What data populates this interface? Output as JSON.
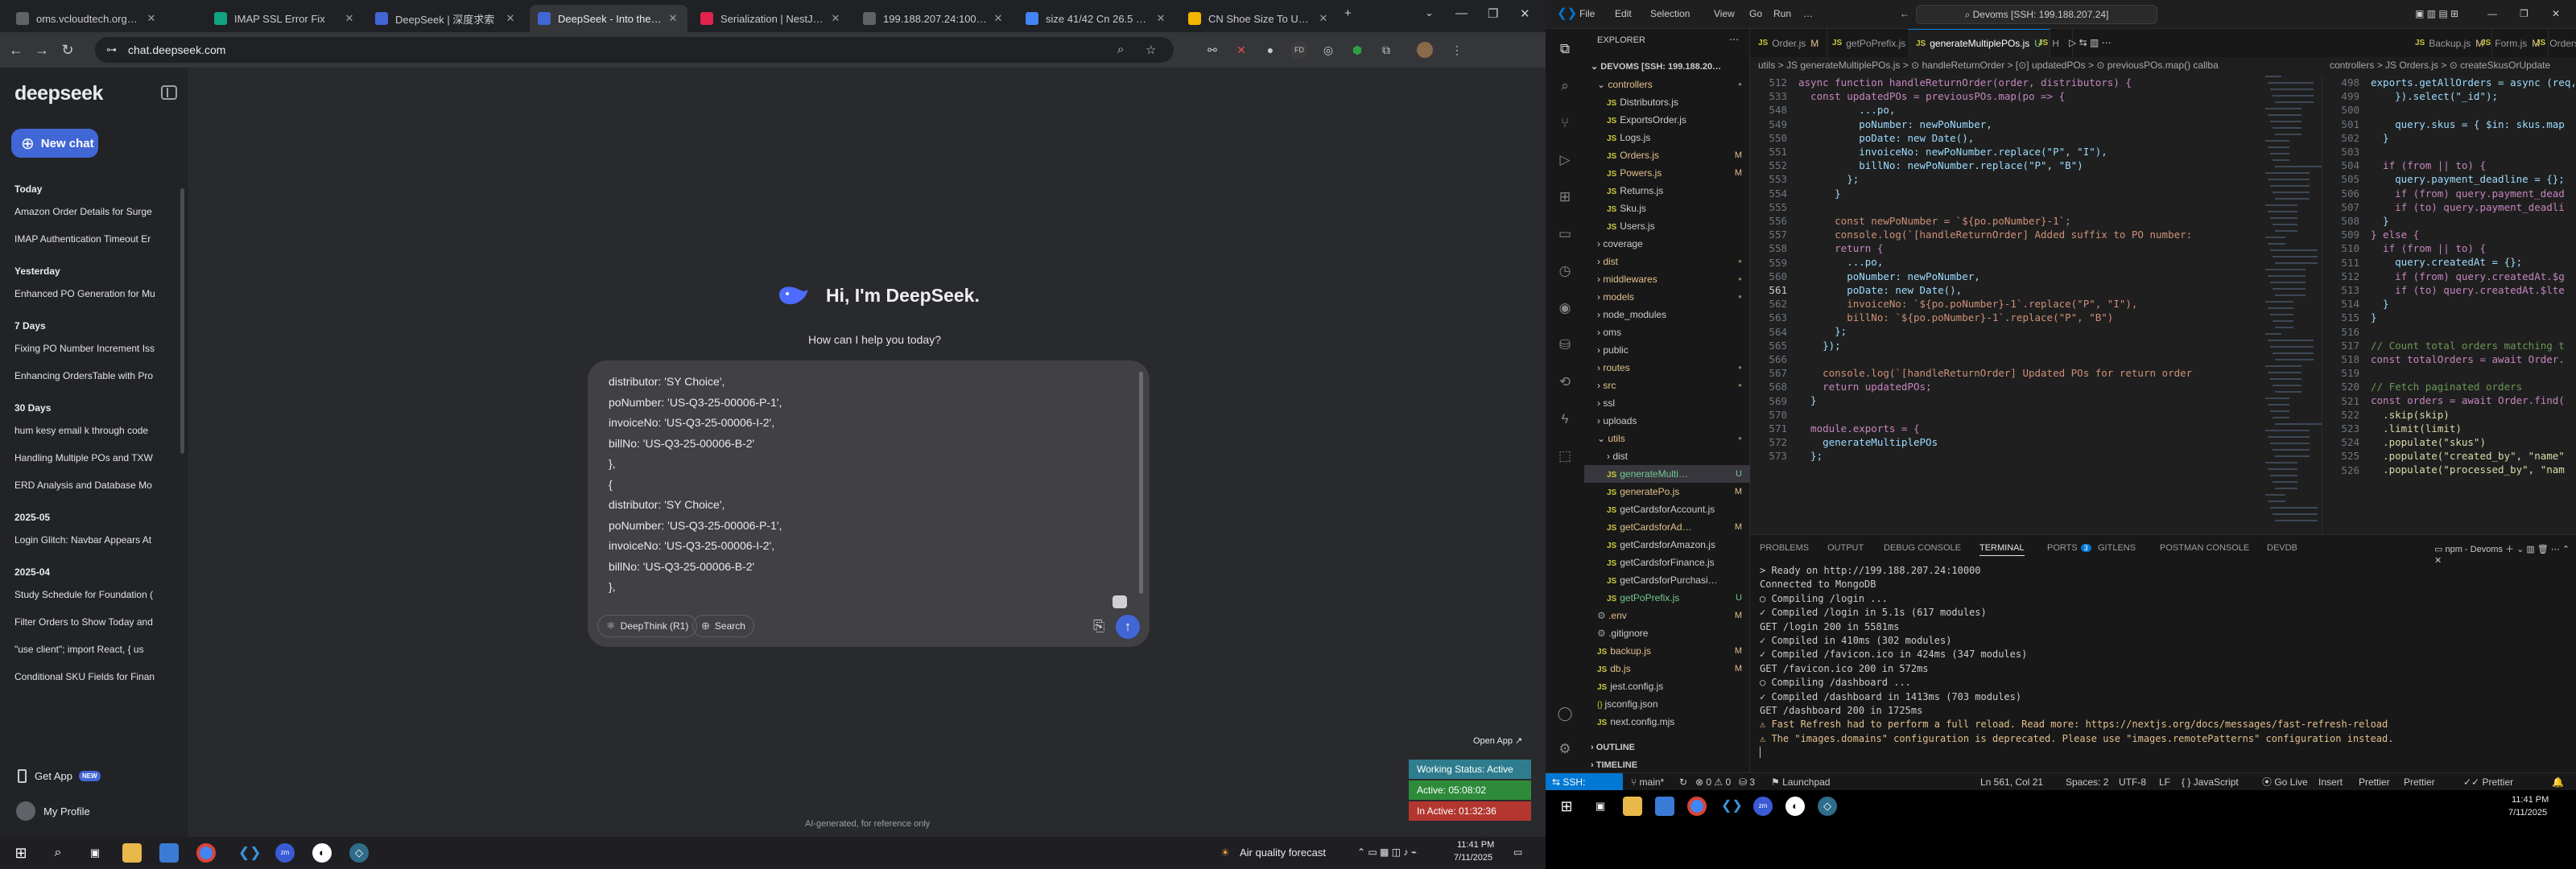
{
  "colors": {
    "accent": "#4166d5",
    "vscode_blue": "#0078d4",
    "chrome_bg": "#202124",
    "ds_bg": "#292a2d"
  },
  "chrome": {
    "tabs": [
      {
        "title": "oms.vcloudtech.org/dash",
        "fav": "#5f6368",
        "icon": "globe-icon"
      },
      {
        "title": "IMAP SSL Error Fix",
        "fav": "#10a37f",
        "icon": "openai-icon"
      },
      {
        "title": "DeepSeek | 深度求索",
        "fav": "#4166d5",
        "icon": "deepseek-icon"
      },
      {
        "title": "DeepSeek - Into the Unkn",
        "fav": "#4166d5",
        "icon": "deepseek-icon"
      },
      {
        "title": "Serialization | NestJS - A",
        "fav": "#e0234e",
        "icon": "nestjs-icon"
      },
      {
        "title": "199.188.207.24:10000/dash",
        "fav": "#5f6368",
        "icon": "globe-icon"
      },
      {
        "title": "size 41/42 Cn 26.5 - Goog",
        "fav": "#4285f4",
        "icon": "google-icon"
      },
      {
        "title": "CN Shoe Size To US - A",
        "fav": "#f4b400",
        "icon": "site-icon"
      }
    ],
    "url": "chat.deepseek.com"
  },
  "deepseek": {
    "logo": "deepseek",
    "new_chat": "New chat",
    "history": [
      {
        "section": "Today",
        "items": [
          "Amazon Order Details for Surge",
          "IMAP Authentication Timeout Er"
        ]
      },
      {
        "section": "Yesterday",
        "items": [
          "Enhanced PO Generation for Mu"
        ]
      },
      {
        "section": "7 Days",
        "items": [
          "Fixing PO Number Increment Iss",
          "Enhancing OrdersTable with Pro"
        ]
      },
      {
        "section": "30 Days",
        "items": [
          "hum kesy email k through code",
          "Handling Multiple POs and TXW",
          "ERD Analysis and Database Mo"
        ]
      },
      {
        "section": "2025-05",
        "items": [
          "Login Glitch: Navbar Appears At"
        ]
      },
      {
        "section": "2025-04",
        "items": [
          "Study Schedule for Foundation (",
          "Filter Orders to Show Today and",
          "\"use client\"; import React, { us",
          "Conditional SKU Fields for Finan"
        ]
      }
    ],
    "get_app": "Get App",
    "new_badge": "NEW",
    "profile": "My Profile",
    "greeting": "Hi, I'm DeepSeek.",
    "subtitle": "How can I help you today?",
    "composer_text": "distributor: 'SY Choice',\npoNumber: 'US-Q3-25-00006-P-1',\ninvoiceNo: 'US-Q3-25-00006-I-2',\nbillNo: 'US-Q3-25-00006-B-2'\n},\n{\ndistributor: 'SY Choice',\npoNumber: 'US-Q3-25-00006-P-1',\ninvoiceNo: 'US-Q3-25-00006-I-2',\nbillNo: 'US-Q3-25-00006-B-2'\n},",
    "deepthink": "DeepThink (R1)",
    "search": "Search",
    "footer": "AI-generated, for reference only"
  },
  "widget": {
    "open_app": "Open App",
    "status": "Working Status: Active",
    "active": "Active: 05:08:02",
    "inactive": "In Active: 01:32:36"
  },
  "win_left": {
    "weather": "Air quality forecast",
    "time": "11:41 PM",
    "date": "7/11/2025"
  },
  "vscode": {
    "menu": [
      "File",
      "Edit",
      "Selection",
      "View",
      "Go",
      "Run",
      "…"
    ],
    "command_center": "Devoms [SSH: 199.188.207.24]",
    "explorer": "EXPLORER",
    "root": "DEVOMS [SSH: 199.188.20…",
    "tree": [
      {
        "name": "controllers",
        "type": "folder",
        "indent": 1,
        "open": true,
        "status": "dot"
      },
      {
        "name": "Distributors.js",
        "type": "js",
        "indent": 2
      },
      {
        "name": "ExportsOrder.js",
        "type": "js",
        "indent": 2
      },
      {
        "name": "Logs.js",
        "type": "js",
        "indent": 2
      },
      {
        "name": "Orders.js",
        "type": "js",
        "indent": 2,
        "status": "M"
      },
      {
        "name": "Powers.js",
        "type": "js",
        "indent": 2,
        "status": "M"
      },
      {
        "name": "Returns.js",
        "type": "js",
        "indent": 2
      },
      {
        "name": "Sku.js",
        "type": "js",
        "indent": 2
      },
      {
        "name": "Users.js",
        "type": "js",
        "indent": 2
      },
      {
        "name": "coverage",
        "type": "folder",
        "indent": 1
      },
      {
        "name": "dist",
        "type": "folder",
        "indent": 1,
        "status": "dot"
      },
      {
        "name": "middlewares",
        "type": "folder",
        "indent": 1,
        "status": "dot"
      },
      {
        "name": "models",
        "type": "folder",
        "indent": 1,
        "status": "dot"
      },
      {
        "name": "node_modules",
        "type": "folder",
        "indent": 1
      },
      {
        "name": "oms",
        "type": "folder",
        "indent": 1
      },
      {
        "name": "public",
        "type": "folder",
        "indent": 1
      },
      {
        "name": "routes",
        "type": "folder",
        "indent": 1,
        "status": "dot"
      },
      {
        "name": "src",
        "type": "folder",
        "indent": 1,
        "status": "dot"
      },
      {
        "name": "ssl",
        "type": "folder",
        "indent": 1
      },
      {
        "name": "uploads",
        "type": "folder",
        "indent": 1
      },
      {
        "name": "utils",
        "type": "folder",
        "indent": 1,
        "open": true,
        "status": "dot"
      },
      {
        "name": "dist",
        "type": "folder",
        "indent": 2
      },
      {
        "name": "generateMulti…",
        "type": "js",
        "indent": 2,
        "status": "U",
        "selected": true
      },
      {
        "name": "generatePo.js",
        "type": "js",
        "indent": 2,
        "status": "M"
      },
      {
        "name": "getCardsforAccount.js",
        "type": "js",
        "indent": 2
      },
      {
        "name": "getCardsforAd…",
        "type": "js",
        "indent": 2,
        "status": "M"
      },
      {
        "name": "getCardsforAmazon.js",
        "type": "js",
        "indent": 2
      },
      {
        "name": "getCardsforFinance.js",
        "type": "js",
        "indent": 2
      },
      {
        "name": "getCardsforPurchasi…",
        "type": "js",
        "indent": 2
      },
      {
        "name": "getPoPrefix.js",
        "type": "js",
        "indent": 2,
        "status": "U"
      },
      {
        "name": ".env",
        "type": "file",
        "indent": 1,
        "status": "M"
      },
      {
        "name": ".gitignore",
        "type": "file",
        "indent": 1
      },
      {
        "name": "backup.js",
        "type": "js",
        "indent": 1,
        "status": "M"
      },
      {
        "name": "db.js",
        "type": "js",
        "indent": 1,
        "status": "M"
      },
      {
        "name": "jest.config.js",
        "type": "js",
        "indent": 1
      },
      {
        "name": "jsconfig.json",
        "type": "json",
        "indent": 1
      },
      {
        "name": "next.config.mjs",
        "type": "js",
        "indent": 1
      }
    ],
    "outline": "OUTLINE",
    "timeline": "TIMELINE",
    "tabs_left": [
      "Order.js",
      "getPoPrefix.js",
      "generateMultiplePOs.js",
      "H"
    ],
    "tabs_left_status": [
      "M",
      "U",
      "U",
      ""
    ],
    "tabs_right": [
      "Backup.js",
      "Form.js",
      "Orders.js"
    ],
    "tabs_right_status": [
      "M",
      "M",
      "M"
    ],
    "crumb_left": "utils > JS generateMultiplePOs.js > ⊙ handleReturnOrder > [⊙] updatedPOs > ⊙ previousPOs.map() callba",
    "crumb_right": "controllers > JS Orders.js > ⊙ createSkusOrUpdate",
    "left_start": 548,
    "left_lines": [
      "async function handleReturnOrder(order, distributors) {",
      "  const updatedPOs = previousPOs.map(po => {",
      "          ...po,",
      "          poNumber: newPoNumber,",
      "          poDate: new Date(),",
      "          invoiceNo: newPoNumber.replace(\"P\", \"I\"),",
      "          billNo: newPoNumber.replace(\"P\", \"B\")",
      "        };",
      "      }",
      "",
      "      const newPoNumber = `${po.poNumber}-1`;",
      "      console.log(`[handleReturnOrder] Added suffix to PO number:",
      "      return {",
      "        ...po,",
      "        poNumber: newPoNumber,",
      "        poDate: new Date(),",
      "        invoiceNo: `${po.poNumber}-1`.replace(\"P\", \"I\"),",
      "        billNo: `${po.poNumber}-1`.replace(\"P\", \"B\")",
      "      };",
      "    });",
      "",
      "    console.log(`[handleReturnOrder] Updated POs for return order",
      "    return updatedPOs;",
      "  }",
      "",
      "  module.exports = {",
      "    generateMultiplePOs",
      "  };"
    ],
    "left_line_numbers": [
      "512",
      "533",
      "548",
      "549",
      "550",
      "551",
      "552",
      "553",
      "554",
      "555",
      "556",
      "557",
      "558",
      "559",
      "560",
      "561",
      "562",
      "563",
      "564",
      "565",
      "566",
      "567",
      "568",
      "569",
      "570",
      "571",
      "572",
      "573"
    ],
    "current_line": "561",
    "right_line_numbers": [
      "498",
      "499",
      "500",
      "501",
      "502",
      "503",
      "504",
      "505",
      "506",
      "507",
      "508",
      "509",
      "510",
      "511",
      "512",
      "513",
      "514",
      "515",
      "516",
      "517",
      "518",
      "519",
      "520",
      "521",
      "522",
      "523",
      "524",
      "525",
      "526"
    ],
    "right_lines": [
      "exports.getAllOrders = async (req, r",
      "    }).select(\"_id\");",
      "",
      "    query.skus = { $in: skus.map",
      "  }",
      "",
      "  if (from || to) {",
      "    query.payment_deadline = {};",
      "    if (from) query.payment_dead",
      "    if (to) query.payment_deadli",
      "  }",
      "} else {",
      "  if (from || to) {",
      "    query.createdAt = {};",
      "    if (from) query.createdAt.$g",
      "    if (to) query.createdAt.$lte",
      "  }",
      "}",
      "",
      "// Count total orders matching t",
      "const totalOrders = await Order.",
      "",
      "// Fetch paginated orders",
      "const orders = await Order.find(",
      "  .skip(skip)",
      "  .limit(limit)",
      "  .populate(\"skus\")",
      "  .populate(\"created_by\", \"name\"",
      "  .populate(\"processed_by\", \"nam"
    ],
    "panel_tabs": [
      "PROBLEMS",
      "OUTPUT",
      "DEBUG CONSOLE",
      "TERMINAL",
      "PORTS",
      "GITLENS",
      "POSTMAN CONSOLE",
      "DEVDB"
    ],
    "ports_count": "3",
    "terminal_label": "npm - Devoms",
    "terminal": [
      "> Ready on http://199.188.207.24:10000",
      "Connected to MongoDB",
      "○ Compiling /login ...",
      "✓ Compiled /login in 5.1s (617 modules)",
      "GET /login 200 in 5581ms",
      "✓ Compiled in 410ms (302 modules)",
      "✓ Compiled /favicon.ico in 424ms (347 modules)",
      "GET /favicon.ico 200 in 572ms",
      "○ Compiling /dashboard ...",
      "✓ Compiled /dashboard in 1413ms (703 modules)",
      "GET /dashboard 200 in 1725ms",
      "⚠ Fast Refresh had to perform a full reload. Read more: https://nextjs.org/docs/messages/fast-refresh-reload",
      "⚠ The \"images.domains\" configuration is deprecated. Please use \"images.remotePatterns\" configuration instead.",
      "▏"
    ],
    "status": {
      "remote": "SSH: 199.188.207.24",
      "branch": "main*",
      "problems": "⊗ 0 ⚠ 0",
      "ports": "⛁ 3",
      "launchpad": "Launchpad",
      "position": "Ln 561, Col 21",
      "spaces": "Spaces: 2",
      "encoding": "UTF-8",
      "eol": "LF",
      "language": "{ } JavaScript",
      "golive": "Go Live",
      "insert": "Insert",
      "prettier": "Prettier",
      "prettier2": "Prettier"
    }
  },
  "win_right": {
    "time": "11:41 PM",
    "date": "7/11/2025"
  }
}
